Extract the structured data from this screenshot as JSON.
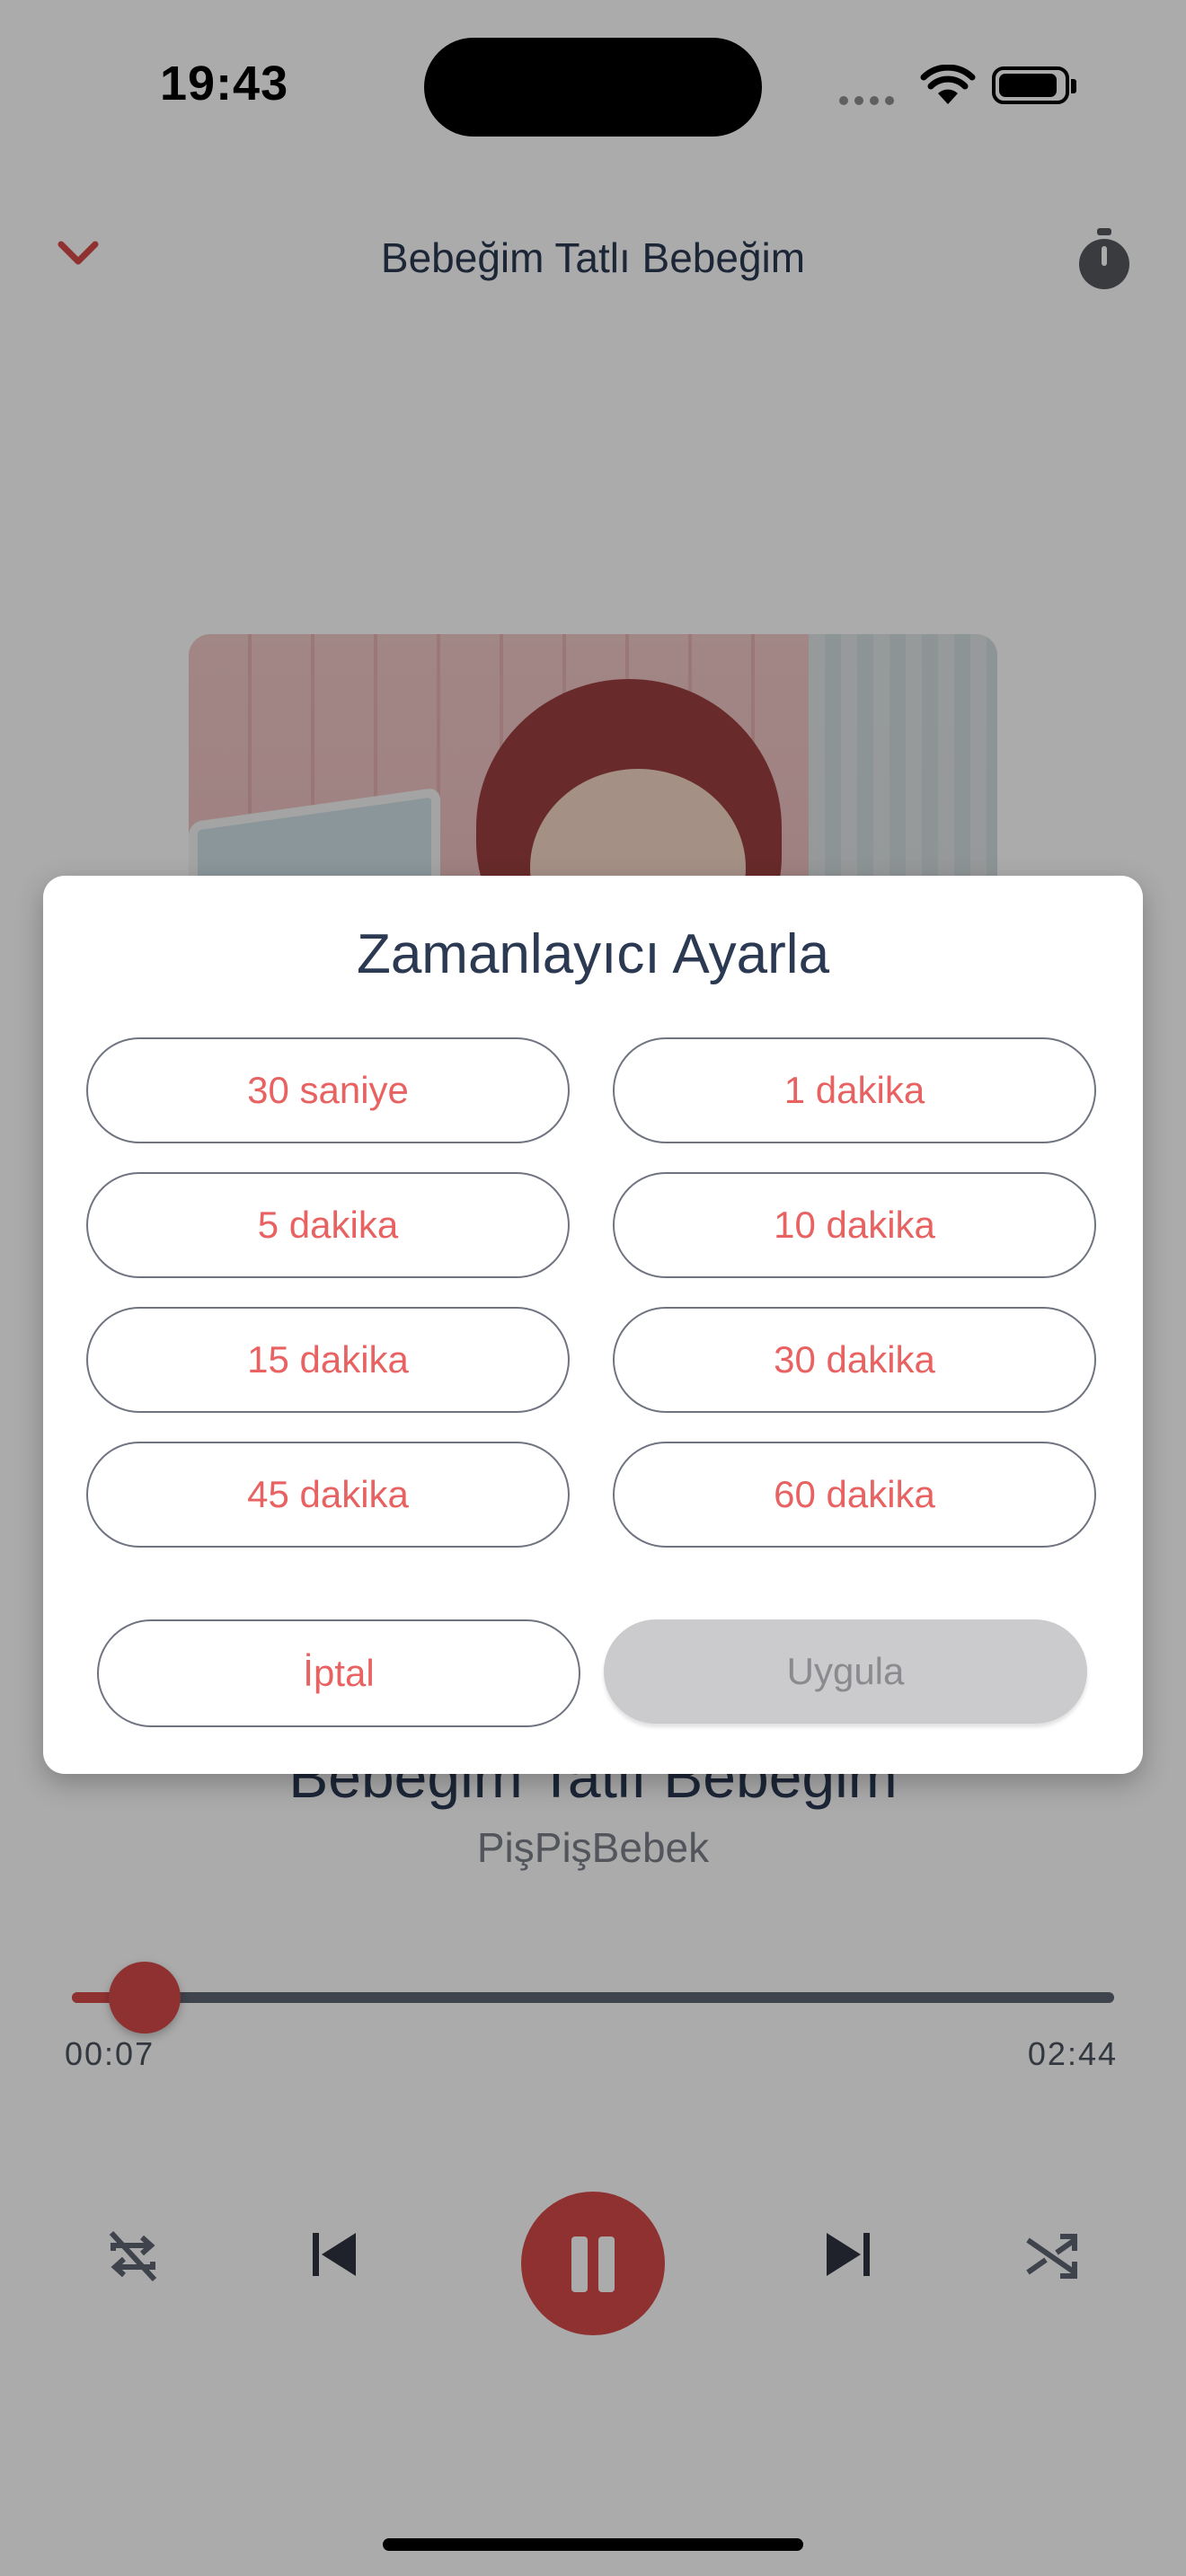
{
  "status_bar": {
    "time": "19:43"
  },
  "header": {
    "title": "Bebeğim Tatlı Bebeğim"
  },
  "song": {
    "title": "Bebeğim Tatlı Bebeğim",
    "artist": "PişPişBebek"
  },
  "player": {
    "elapsed": "00:07",
    "total": "02:44",
    "progress": 0.07
  },
  "dialog": {
    "title": "Zamanlayıcı Ayarla",
    "options": [
      "30 saniye",
      "1 dakika",
      "5 dakika",
      "10 dakika",
      "15 dakika",
      "30 dakika",
      "45 dakika",
      "60 dakika"
    ],
    "cancel_label": "İptal",
    "apply_label": "Uygula"
  },
  "colors": {
    "accent": "#d64a4a",
    "option_text": "#e86262",
    "title_text": "#2b3a52"
  },
  "icons": [
    "chevron-down-icon",
    "timer-icon",
    "repeat-off-icon",
    "previous-icon",
    "pause-icon",
    "next-icon",
    "shuffle-icon"
  ]
}
